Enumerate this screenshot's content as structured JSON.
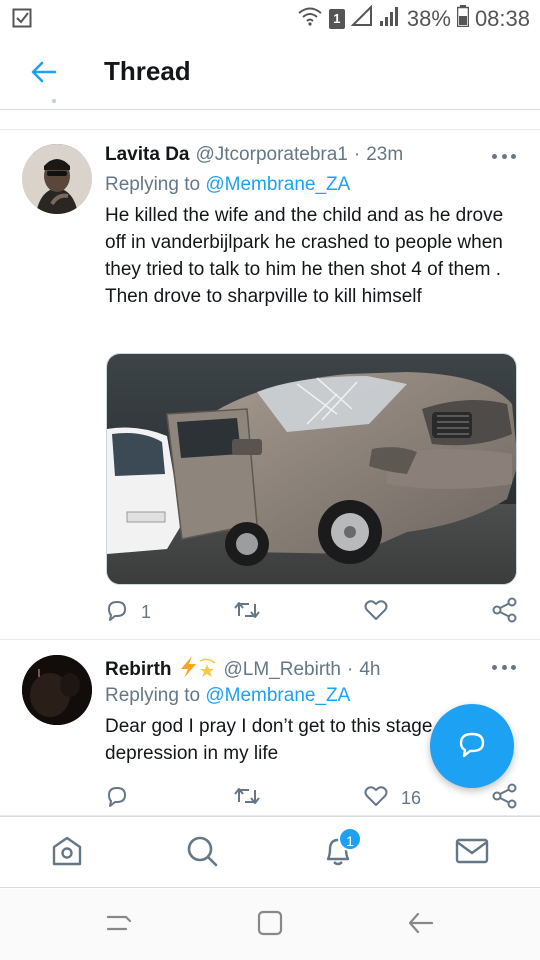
{
  "status_bar": {
    "sim_label": "1",
    "battery": "38%",
    "time": "08:38"
  },
  "header": {
    "title": "Thread"
  },
  "tweets": [
    {
      "author": "Lavita Da",
      "handle": "@Jtcorporatebra1",
      "separator": "·",
      "time": "23m",
      "replying_prefix": "Replying to",
      "replying_to": "@Membrane_ZA",
      "text": "He killed the wife and the child and as he drove off in vanderbijlpark he crashed  to people when they tried to talk to him he then shot 4 of them . Then drove to sharpville to kill himself",
      "reply_count": "1",
      "retweet_count": "",
      "like_count": ""
    },
    {
      "author": "Rebirth",
      "author_emoji": "⚡💫",
      "handle": "@LM_Rebirth",
      "separator": "·",
      "time": "4h",
      "replying_prefix": "Replying to",
      "replying_to": "@Membrane_ZA",
      "text": "Dear god I pray I don’t get to this stage of depression in my life",
      "reply_count": "",
      "retweet_count": "",
      "like_count": "16"
    }
  ],
  "bottom_nav": {
    "notifications_badge": "1"
  },
  "colors": {
    "accent": "#1da1f2",
    "text": "#14171a",
    "muted": "#657786"
  }
}
